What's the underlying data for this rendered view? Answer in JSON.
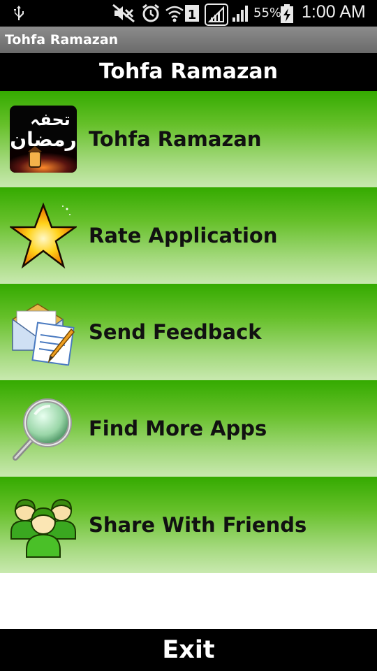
{
  "status_bar": {
    "battery_percent": "55%",
    "time": "1:00 AM",
    "icons": [
      "usb-icon",
      "mute-icon",
      "alarm-icon",
      "wifi-icon",
      "sim-1-icon",
      "signal-icon",
      "signal-2-icon",
      "battery-charging-icon"
    ]
  },
  "app": {
    "window_title": "Tohfa Ramazan",
    "header_title": "Tohfa Ramazan"
  },
  "menu": {
    "items": [
      {
        "label": "Tohfa Ramazan",
        "icon": "tohfa-ramazan-logo-icon",
        "logo_text": [
          "تحفہ",
          "رمضان"
        ]
      },
      {
        "label": "Rate Application",
        "icon": "star-icon"
      },
      {
        "label": "Send Feedback",
        "icon": "mail-edit-icon"
      },
      {
        "label": "Find More Apps",
        "icon": "magnifier-icon"
      },
      {
        "label": "Share With Friends",
        "icon": "people-icon"
      }
    ]
  },
  "footer": {
    "exit_label": "Exit"
  },
  "colors": {
    "menu_green_top": "#34aa00",
    "menu_green_bottom": "#c8e9af",
    "bar_black": "#000000"
  }
}
